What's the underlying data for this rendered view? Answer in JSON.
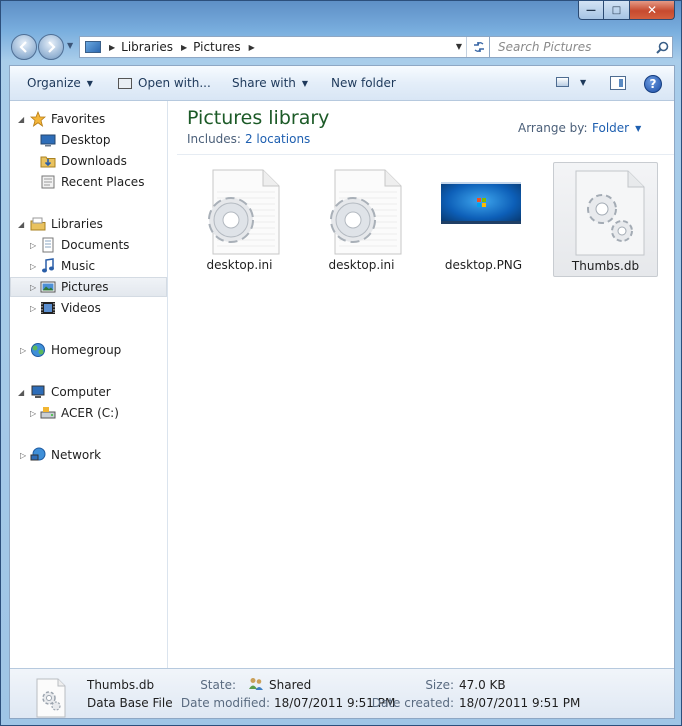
{
  "window": {
    "close_glyph": "✕",
    "max_glyph": "□",
    "min_glyph": "—"
  },
  "address": {
    "crumbs": [
      "Libraries",
      "Pictures"
    ]
  },
  "search": {
    "placeholder": "Search Pictures"
  },
  "toolbar": {
    "organize": "Organize",
    "open_with": "Open with...",
    "share_with": "Share with",
    "new_folder": "New folder",
    "help": "?"
  },
  "navpane": {
    "favorites": {
      "label": "Favorites",
      "items": [
        "Desktop",
        "Downloads",
        "Recent Places"
      ]
    },
    "libraries": {
      "label": "Libraries",
      "items": [
        "Documents",
        "Music",
        "Pictures",
        "Videos"
      ]
    },
    "homegroup": "Homegroup",
    "computer": {
      "label": "Computer",
      "items": [
        "ACER (C:)"
      ]
    },
    "network": "Network"
  },
  "library": {
    "title": "Pictures library",
    "includes_label": "Includes:",
    "includes_link": "2 locations",
    "arrange_label": "Arrange by:",
    "arrange_value": "Folder"
  },
  "files": [
    {
      "name": "desktop.ini",
      "kind": "gear-file-icon"
    },
    {
      "name": "desktop.ini",
      "kind": "gear-file-icon"
    },
    {
      "name": "desktop.PNG",
      "kind": "image-thumbnail"
    },
    {
      "name": "Thumbs.db",
      "kind": "gear-file-icon"
    }
  ],
  "details": {
    "name": "Thumbs.db",
    "type": "Data Base File",
    "state_label": "State:",
    "state_value": "Shared",
    "size_label": "Size:",
    "size_value": "47.0 KB",
    "modified_label": "Date modified:",
    "modified_value": "18/07/2011 9:51 PM",
    "created_label": "Date created:",
    "created_value": "18/07/2011 9:51 PM"
  },
  "colors": {
    "accent": "#1e5fb0",
    "library_title": "#1c5a27",
    "selection": "#e6e8eb"
  }
}
